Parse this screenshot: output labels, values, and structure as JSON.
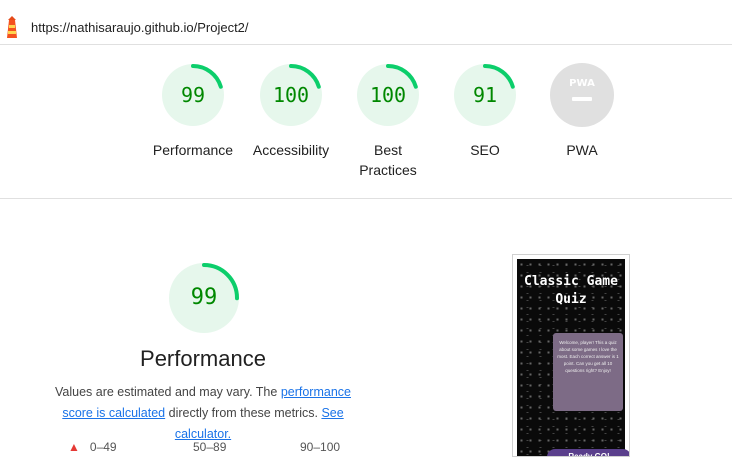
{
  "header": {
    "url": "https://nathisaraujo.github.io/Project2/"
  },
  "gauges": [
    {
      "label": "Performance",
      "score": "99",
      "value": 99
    },
    {
      "label": "Accessibility",
      "score": "100",
      "value": 100
    },
    {
      "label": "Best Practices",
      "score": "100",
      "value": 100
    },
    {
      "label": "SEO",
      "score": "91",
      "value": 91
    },
    {
      "label": "PWA",
      "score": "PWA",
      "value": null
    }
  ],
  "performance": {
    "score": "99",
    "title": "Performance",
    "desc_prefix": "Values are estimated and may vary. The ",
    "link_score": "performance score is calculated",
    "desc_middle": " directly from these metrics. ",
    "link_calc": "See calculator."
  },
  "legend": {
    "fail": "0–49",
    "average": "50–89",
    "pass": "90–100"
  },
  "thumbnail": {
    "title": "Classic Game Quiz",
    "card_text": "Welcome, player! This a quiz about some games I love the most. Each correct answer is 1 point. Can you get all 10 questions right? Enjoy!",
    "button": "Ready GO!"
  },
  "colors": {
    "pass": "#0cce6b",
    "pass_bg": "#e6f7ec",
    "score_text": "#008800",
    "pwa_bg": "#e0e0e0"
  }
}
